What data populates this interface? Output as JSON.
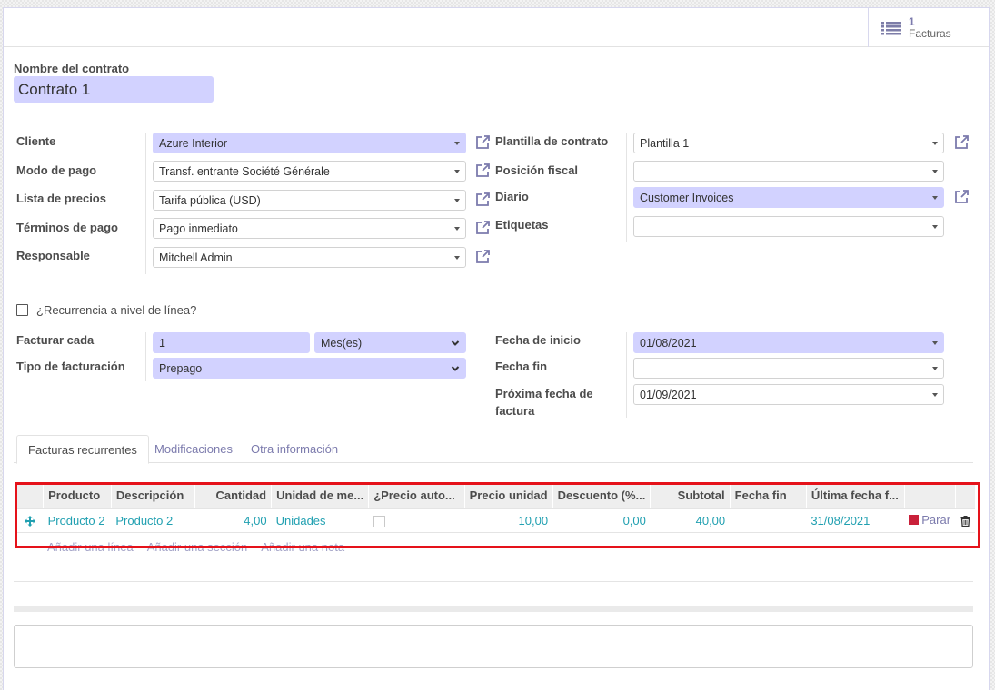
{
  "smart_button": {
    "count": "1",
    "label": "Facturas",
    "icon": "list-icon"
  },
  "contract": {
    "name_label": "Nombre del contrato",
    "name_value": "Contrato 1"
  },
  "left_fields": [
    {
      "label": "Cliente",
      "value": "Azure Interior",
      "required": true
    },
    {
      "label": "Modo de pago",
      "value": "Transf. entrante Société Générale",
      "required": false
    },
    {
      "label": "Lista de precios",
      "value": "Tarifa pública (USD)",
      "required": false
    },
    {
      "label": "Términos de pago",
      "value": "Pago inmediato",
      "required": false
    },
    {
      "label": "Responsable",
      "value": "Mitchell Admin",
      "required": false
    }
  ],
  "right_fields": [
    {
      "label": "Plantilla de contrato",
      "value": "Plantilla 1",
      "required": false
    },
    {
      "label": "Posición fiscal",
      "value": "",
      "required": false
    },
    {
      "label": "Diario",
      "value": "Customer Invoices",
      "required": true
    },
    {
      "label": "Etiquetas",
      "value": "",
      "required": false
    }
  ],
  "line_recurrence": {
    "label": "¿Recurrencia a nivel de línea?",
    "checked": false
  },
  "billing": {
    "interval_label": "Facturar cada",
    "interval_value": "1",
    "interval_unit": "Mes(es)",
    "type_label": "Tipo de facturación",
    "type_value": "Prepago"
  },
  "dates": {
    "start_label": "Fecha de inicio",
    "start_value": "01/08/2021",
    "end_label": "Fecha fin",
    "end_value": "",
    "next_label": "Próxima fecha de factura",
    "next_value": "01/09/2021"
  },
  "tabs": [
    {
      "label": "Facturas recurrentes",
      "active": true
    },
    {
      "label": "Modificaciones",
      "active": false
    },
    {
      "label": "Otra información",
      "active": false
    }
  ],
  "lines_table": {
    "headers": [
      "Producto",
      "Descripción",
      "Cantidad",
      "Unidad de me...",
      "¿Precio auto...",
      "Precio unidad",
      "Descuento (%...",
      "Subtotal",
      "Fecha fin",
      "Última fecha f..."
    ],
    "rows": [
      {
        "product": "Producto 2",
        "description": "Producto 2",
        "quantity": "4,00",
        "uom": "Unidades",
        "auto_price": false,
        "unit_price": "10,00",
        "discount": "0,00",
        "subtotal": "40,00",
        "date_end": "",
        "last_invoice_date": "31/08/2021",
        "stop_label": "Parar"
      }
    ],
    "add_line": "Añadir una línea",
    "add_section": "Añadir una sección",
    "add_note": "Añadir una nota"
  },
  "colors": {
    "required_bg": "#d2d2ff",
    "link": "#21a0b1",
    "accent": "#7c7bad",
    "stop": "#c9203a",
    "highlight": "#e5121a"
  }
}
